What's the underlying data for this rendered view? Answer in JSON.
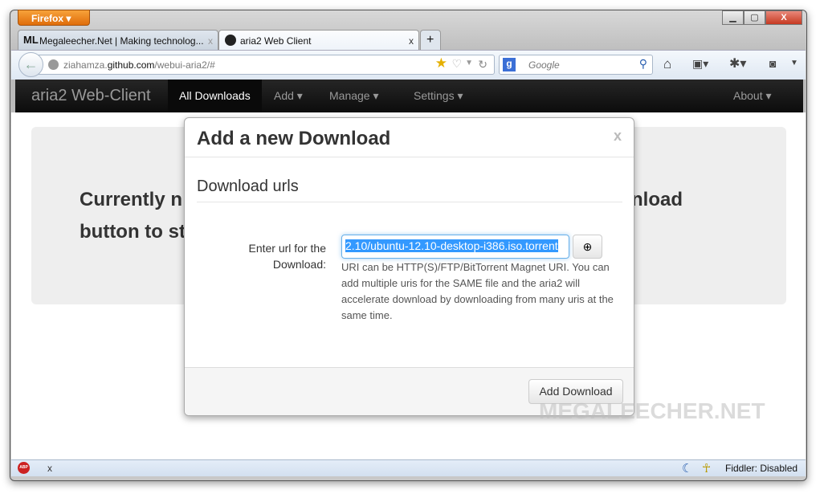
{
  "browser": {
    "menu_label": "Firefox",
    "window_controls": {
      "minimize": "▁",
      "maximize": "▢",
      "close": "X"
    },
    "tabs": [
      {
        "title": "Megaleecher.Net | Making technolog...",
        "active": false
      },
      {
        "title": "aria2 Web Client",
        "active": true
      }
    ],
    "new_tab": "+",
    "tab_close": "x",
    "url": {
      "domain_prefix": "ziahamza.",
      "domain": "github.com",
      "path": "/webui-aria2/#"
    },
    "search": {
      "engine": "g",
      "placeholder": "Google"
    }
  },
  "navbar": {
    "brand": "aria2 Web-Client",
    "items": [
      {
        "label": "All Downloads",
        "active": true
      },
      {
        "label": "Add ▾"
      },
      {
        "label": "Manage ▾"
      },
      {
        "label": "Settings ▾"
      }
    ],
    "right": "About ▾"
  },
  "hero": {
    "line1_left": "Currently n",
    "line1_right": "nload",
    "line2": "button to st"
  },
  "modal": {
    "title": "Add a new Download",
    "close": "x",
    "section": "Download urls",
    "field_label_1": "Enter url for the",
    "field_label_2": "Download:",
    "url_value": "2.10/ubuntu-12.10-desktop-i386.iso.torrent",
    "help": "URI can be HTTP(S)/FTP/BitTorrent Magnet URI. You can add multiple uris for the SAME file and the aria2 will accelerate download by downloading from many uris at the same time.",
    "submit": "Add Download"
  },
  "watermark": "MEGALEECHER.NET",
  "statusbar": {
    "abp": "ABP",
    "close": "x",
    "fiddler": "Fiddler: Disabled"
  },
  "colors": {
    "firefox_orange": "#e8821e",
    "navbar": "#1b1b1b",
    "selection": "#3399ff"
  }
}
